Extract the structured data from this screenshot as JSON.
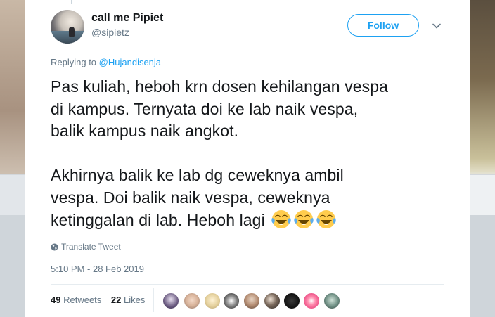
{
  "tweet": {
    "author": {
      "name": "call me Pipiet",
      "handle": "@sipietz",
      "avatar_icon": "avatar"
    },
    "follow_label": "Follow",
    "replying_prefix": "Replying to",
    "replying_to": "@Hujandisenja",
    "text_paragraph_1": [
      "Pas kuliah, heboh krn dosen kehilangan vespa",
      "di kampus. Ternyata doi ke lab naik vespa,",
      "balik kampus naik angkot."
    ],
    "text_paragraph_2": [
      "Akhirnya balik ke lab dg ceweknya ambil",
      "vespa. Doi balik naik vespa, ceweknya",
      "ketinggalan di lab. Heboh lagi"
    ],
    "emojis": [
      "face-with-tears-of-joy",
      "face-with-tears-of-joy",
      "face-with-tears-of-joy"
    ],
    "translate_label": "Translate Tweet",
    "timestamp": "5:10 PM - 28 Feb 2019",
    "retweets_count": "49",
    "retweets_label": "Retweets",
    "likes_count": "22",
    "likes_label": "Likes",
    "liker_avatars": [
      "avatar",
      "avatar",
      "avatar",
      "avatar",
      "avatar",
      "avatar",
      "avatar",
      "avatar",
      "avatar"
    ]
  },
  "colors": {
    "accent": "#1da1f2",
    "text_primary": "#14171a",
    "text_secondary": "#657786",
    "divider": "#e6ecf0"
  }
}
